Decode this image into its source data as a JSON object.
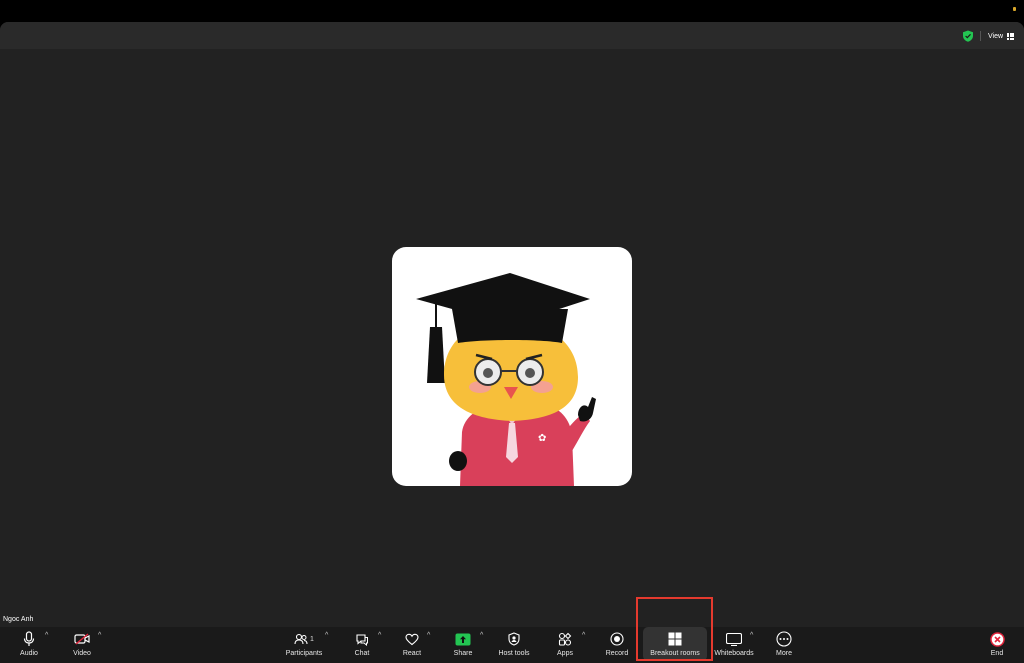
{
  "header": {
    "view_label": "View"
  },
  "participant": {
    "name": "Ngoc Anh"
  },
  "toolbar": {
    "audio": "Audio",
    "video": "Video",
    "participants": "Participants",
    "participants_count": "1",
    "chat": "Chat",
    "react": "React",
    "share": "Share",
    "host_tools": "Host tools",
    "apps": "Apps",
    "record": "Record",
    "breakout_rooms": "Breakout rooms",
    "whiteboards": "Whiteboards",
    "more": "More",
    "end": "End"
  },
  "colors": {
    "highlight": "#e53a2e",
    "share_green": "#23c552",
    "end_red": "#e0253c",
    "shield_green": "#23c552"
  }
}
